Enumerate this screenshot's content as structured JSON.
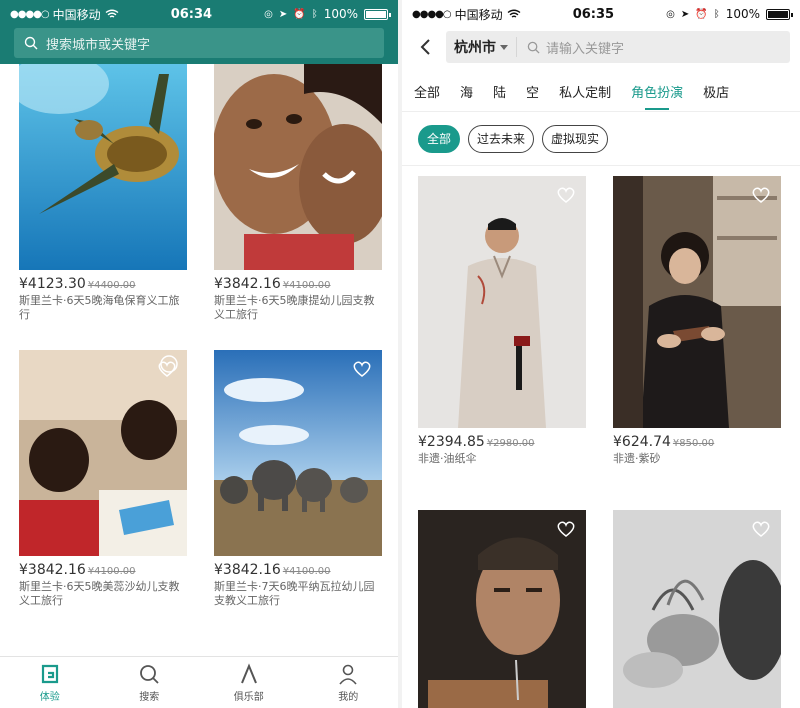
{
  "left": {
    "status": {
      "carrier": "中国移动",
      "time": "06:34",
      "battery": "100%"
    },
    "search_placeholder": "搜索城市或关键字",
    "cards": [
      {
        "price": "¥4123.30",
        "original": "¥4400.00",
        "title": "斯里兰卡·6天5晚海龟保育义工旅行"
      },
      {
        "price": "¥3842.16",
        "original": "¥4100.00",
        "title": "斯里兰卡·6天5晚康提幼儿园支教义工旅行"
      },
      {
        "price": "¥3842.16",
        "original": "¥4100.00",
        "title": "斯里兰卡·6天5晚美蕊沙幼儿支教义工旅行"
      },
      {
        "price": "¥3842.16",
        "original": "¥4100.00",
        "title": "斯里兰卡·7天6晚平纳瓦拉幼儿园支教义工旅行"
      }
    ],
    "tabs": [
      {
        "label": "体验",
        "icon": "experience-icon",
        "active": true
      },
      {
        "label": "搜索",
        "icon": "search-icon"
      },
      {
        "label": "俱乐部",
        "icon": "club-icon"
      },
      {
        "label": "我的",
        "icon": "profile-icon"
      }
    ]
  },
  "right": {
    "status": {
      "carrier": "中国移动",
      "time": "06:35",
      "battery": "100%"
    },
    "city": "杭州市",
    "search_placeholder": "请输入关键字",
    "categories": [
      "全部",
      "海",
      "陆",
      "空",
      "私人定制",
      "角色扮演",
      "极店"
    ],
    "active_category": "角色扮演",
    "subtags": [
      "全部",
      "过去未来",
      "虚拟现实"
    ],
    "active_subtag": "全部",
    "cards": [
      {
        "price": "¥2394.85",
        "original": "¥2980.00",
        "title": "非遗·油纸伞"
      },
      {
        "price": "¥624.74",
        "original": "¥850.00",
        "title": "非遗·紫砂"
      }
    ]
  },
  "accent_color": "#1a9a8c",
  "header_color": "#1a7c73"
}
